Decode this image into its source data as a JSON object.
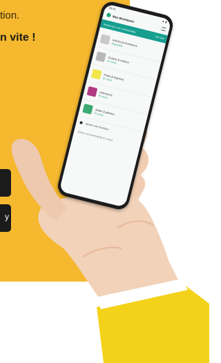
{
  "promo": {
    "line1": "tion.",
    "line2": "n vite !",
    "store_buttons": [
      "",
      "y"
    ]
  },
  "phone": {
    "status_time": "09:41",
    "status_icons": "▲ ▮",
    "app_title": "Mes Boutiques",
    "banner_text": "Retrouvez vos commandes",
    "banner_action": "Voir tout",
    "items": [
      {
        "title": "Articles & fournitures",
        "subtitle": "Disponible",
        "color": "#c9c9c9"
      },
      {
        "title": "Cuisine & maison",
        "subtitle": "En stock",
        "color": "#b8b8b8"
      },
      {
        "title": "Fruits & légumes",
        "subtitle": "En stock",
        "color": "#f1e54a"
      },
      {
        "title": "Vêtements",
        "subtitle": "En stock",
        "color": "#b13a83"
      },
      {
        "title": "Jardin & plantes",
        "subtitle": "En stock",
        "color": "#3cab73"
      }
    ],
    "footer_label": "Ajouter une boutique",
    "bottom_link": "Suivre ma commande en cours"
  },
  "colors": {
    "panel": "#f5b82e",
    "accent": "#169e8f",
    "sleeve": "#f3d21a",
    "skin": "#f2d2b8"
  }
}
